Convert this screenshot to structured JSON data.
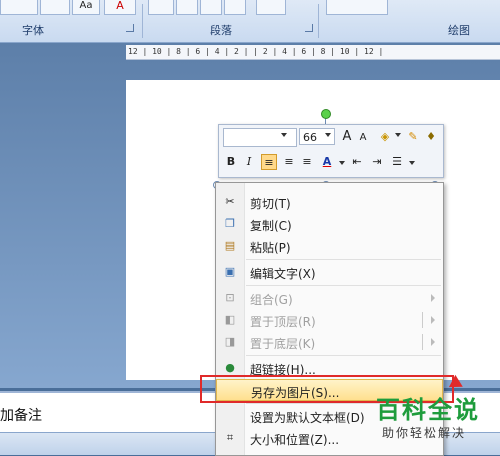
{
  "ribbon": {
    "groups": [
      {
        "name": "font",
        "label": "字体"
      },
      {
        "name": "paragraph",
        "label": "段落"
      },
      {
        "name": "drawing",
        "label": "绘图"
      }
    ],
    "top_glyphs": {
      "aa": "Aa",
      "a": "A"
    }
  },
  "ruler": {
    "marks": "12 | 10 | 8 | 6 | 4 | 2 | | 2 | 4 | 6 | 8 | 10 | 12 |"
  },
  "mini_toolbar": {
    "font_name": "",
    "font_size": "66",
    "grow": "A",
    "shrink": "A",
    "bold": "B",
    "italic": "I",
    "font_color": "A",
    "icons": [
      "grow-font-icon",
      "shrink-font-icon",
      "fill-color-icon",
      "line-color-icon",
      "format-painter-icon",
      "align-left-icon",
      "align-center-icon",
      "align-right-icon",
      "font-color-icon",
      "decrease-indent-icon",
      "increase-indent-icon",
      "bullets-icon"
    ]
  },
  "context_menu": {
    "items": [
      {
        "label": "剪切(T)",
        "icon": "scissors-icon",
        "enabled": true
      },
      {
        "label": "复制(C)",
        "icon": "copy-icon",
        "enabled": true
      },
      {
        "label": "粘贴(P)",
        "icon": "paste-icon",
        "enabled": true
      },
      {
        "label": "编辑文字(X)",
        "icon": "edit-text-icon",
        "enabled": true
      },
      {
        "label": "组合(G)",
        "icon": "group-icon",
        "enabled": false,
        "submenu": true
      },
      {
        "label": "置于顶层(R)",
        "icon": "bring-front-icon",
        "enabled": false,
        "submenu": true
      },
      {
        "label": "置于底层(K)",
        "icon": "send-back-icon",
        "enabled": false,
        "submenu": true
      },
      {
        "label": "超链接(H)...",
        "icon": "hyperlink-icon",
        "enabled": true
      },
      {
        "label": "另存为图片(S)...",
        "icon": "",
        "enabled": true,
        "highlighted": true
      },
      {
        "label": "设置为默认文本框(D)",
        "icon": "",
        "enabled": true
      },
      {
        "label": "大小和位置(Z)...",
        "icon": "size-position-icon",
        "enabled": true
      }
    ]
  },
  "notes": {
    "text": "加备注"
  },
  "watermark": {
    "line1": "百科全说",
    "line2": "助你轻松解决"
  },
  "colors": {
    "accent": "#e02a2a",
    "highlight": "#ffe08f",
    "brand_green": "#1e9c3c"
  }
}
